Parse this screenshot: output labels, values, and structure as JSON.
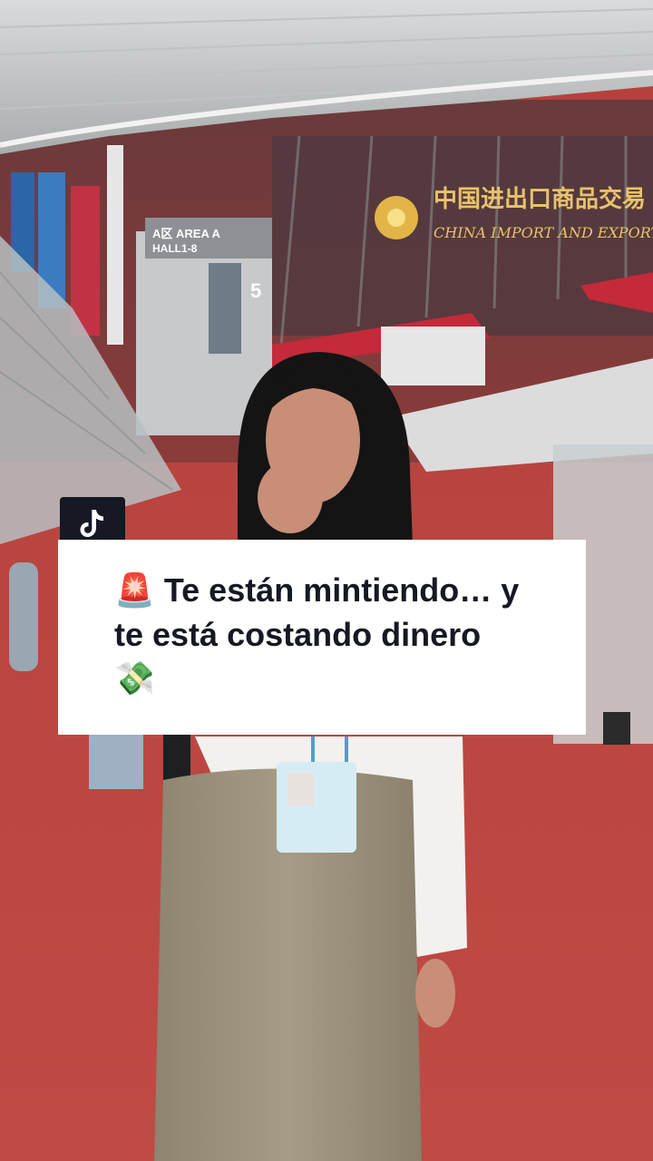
{
  "caption": {
    "lead_emoji": "🚨",
    "text": "Te están mintiendo… y te está costando dinero",
    "trail_emoji": "💸"
  },
  "signage": {
    "area_sign_line1": "A区 AREA A",
    "area_sign_line2": "HALL1-8",
    "hall_number": "5",
    "fair_name_chinese": "中国进出口商品交易",
    "fair_name_english": "CHINA IMPORT AND EXPORT F"
  },
  "icons": {
    "app_badge": "tiktok-logo-icon"
  },
  "colors": {
    "carpet": "#b8433f",
    "caption_background": "#ffffff",
    "caption_text": "#161823",
    "badge_background": "#161823"
  }
}
